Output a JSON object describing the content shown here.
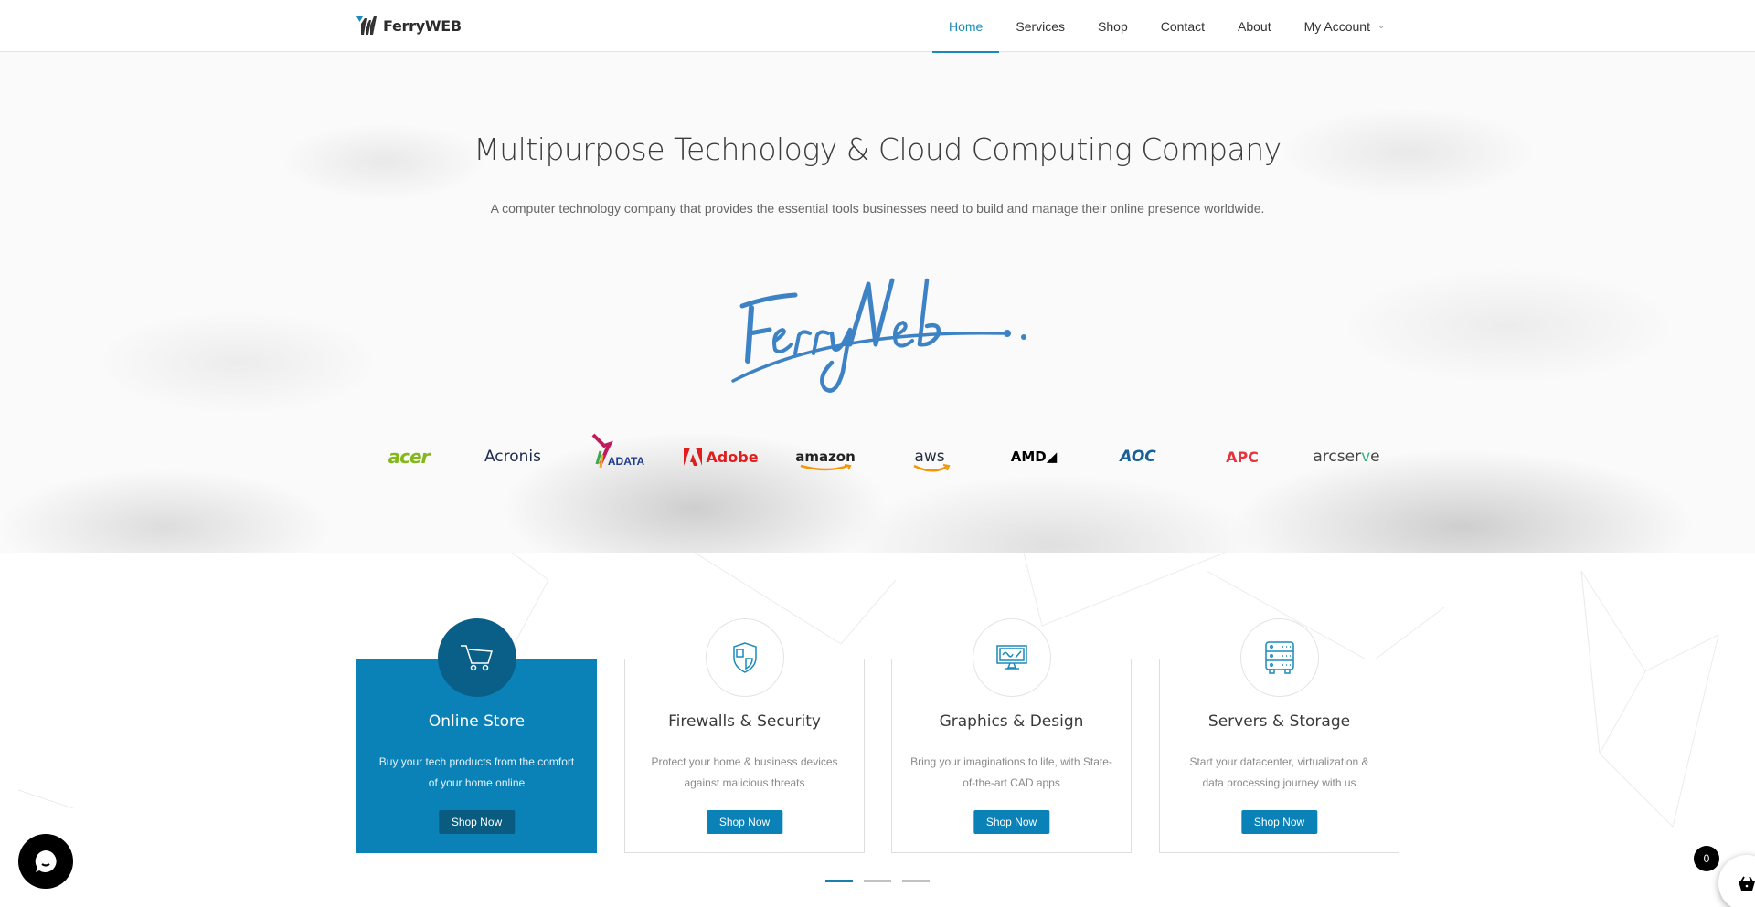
{
  "brand": {
    "name_part1": "Ferry",
    "name_part2": "WEB",
    "accent_color": "#0a82b8"
  },
  "nav": {
    "items": [
      {
        "label": "Home",
        "active": true
      },
      {
        "label": "Services",
        "active": false
      },
      {
        "label": "Shop",
        "active": false
      },
      {
        "label": "Contact",
        "active": false
      },
      {
        "label": "About",
        "active": false
      },
      {
        "label": "My Account",
        "active": false,
        "has_dropdown": true
      }
    ],
    "dropdown_icon": "chevron-down-icon"
  },
  "hero": {
    "title": "Multipurpose Technology & Cloud Computing Company",
    "subtitle": "A computer technology company that provides the essential tools businesses need to build and manage their online presence worldwide.",
    "signature_text": "FerryWeb."
  },
  "partners": [
    {
      "name": "acer"
    },
    {
      "name": "Acronis"
    },
    {
      "name": "ADATA"
    },
    {
      "name": "Adobe"
    },
    {
      "name": "amazon"
    },
    {
      "name": "aws"
    },
    {
      "name": "AMD"
    },
    {
      "name": "AOC"
    },
    {
      "name": "APC"
    },
    {
      "name": "arcserve"
    }
  ],
  "services": [
    {
      "title": "Online Store",
      "description": "Buy your tech products from the comfort of your home online",
      "button": "Shop Now",
      "icon": "shopping-cart-icon",
      "featured": true
    },
    {
      "title": "Firewalls & Security",
      "description": "Protect your home & business devices against malicious threats",
      "button": "Shop Now",
      "icon": "shield-icon",
      "featured": false
    },
    {
      "title": "Graphics & Design",
      "description": "Bring your imaginations to life, with State-of-the-art CAD apps",
      "button": "Shop Now",
      "icon": "monitor-icon",
      "featured": false
    },
    {
      "title": "Servers & Storage",
      "description": "Start your datacenter, virtualization & data processing journey with us",
      "button": "Shop Now",
      "icon": "server-icon",
      "featured": false
    }
  ],
  "carousel": {
    "pages": 3,
    "active_page": 1
  },
  "cart": {
    "count": "0"
  }
}
